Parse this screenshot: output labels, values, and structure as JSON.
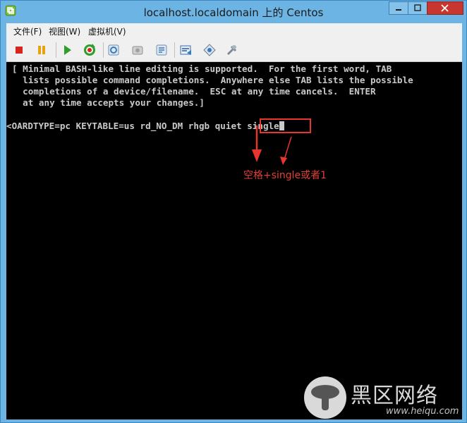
{
  "window": {
    "title": "localhost.localdomain 上的 Centos"
  },
  "menu": [
    {
      "label": "文件(F)"
    },
    {
      "label": "视图(W)"
    },
    {
      "label": "虚拟机(V)"
    }
  ],
  "toolbar": {
    "icons": [
      "stop-icon",
      "pause-icon",
      "play-icon",
      "reset-icon",
      "snapshot-icon",
      "revert-snapshot-icon",
      "snapshot-manager-icon",
      "vm-settings-icon",
      "network-icon",
      "tools-icon"
    ]
  },
  "console": {
    "help_line1": "[ Minimal BASH-like line editing is supported.  For the first word, TAB",
    "help_line2": "  lists possible command completions.  Anywhere else TAB lists the possible",
    "help_line3": "  completions of a device/filename.  ESC at any time cancels.  ENTER",
    "help_line4": "  at any time accepts your changes.]",
    "command_prefix": "<OARDTYPE=pc KEYTABLE=us rd_NO_DM rhgb quiet ",
    "command_highlight": "single"
  },
  "annotation": {
    "text": "空格+single或者1",
    "color": "#e23f36"
  },
  "watermark": {
    "title": "黑区网络",
    "url": "www.heiqu.com"
  },
  "colors": {
    "titlebar": "#6cb4e4",
    "close_button": "#c7372f",
    "console_bg": "#000000",
    "console_text": "#c9c9c9",
    "highlight": "#e8352d"
  }
}
